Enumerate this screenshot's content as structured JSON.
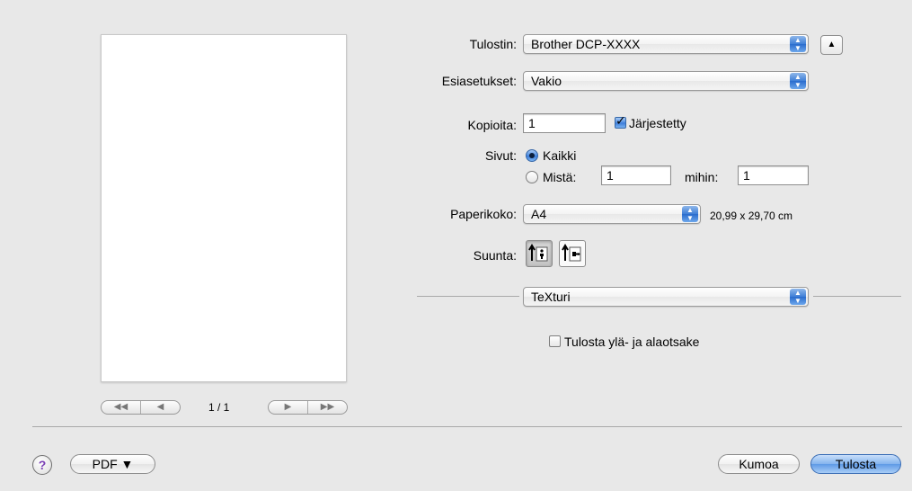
{
  "preview": {
    "page_counter": "1 / 1",
    "nav_first": "◀◀",
    "nav_prev": "◀",
    "nav_next": "▶",
    "nav_last": "▶▶"
  },
  "printer": {
    "label": "Tulostin:",
    "value": "Brother DCP-XXXX"
  },
  "presets": {
    "label": "Esiasetukset:",
    "value": "Vakio"
  },
  "copies": {
    "label": "Kopioita:",
    "value": "1",
    "collated_label": "Järjestetty",
    "collated_checked": true
  },
  "pages": {
    "label": "Sivut:",
    "all_label": "Kaikki",
    "from_label": "Mistä:",
    "from_value": "1",
    "to_label": "mihin:",
    "to_value": "1",
    "selected": "Kaikki"
  },
  "paper_size": {
    "label": "Paperikoko:",
    "value": "A4",
    "dimensions": "20,99 x 29,70 cm"
  },
  "orientation": {
    "label": "Suunta:",
    "selected": "portrait"
  },
  "section": {
    "value": "TeXturi"
  },
  "header_footer": {
    "label": "Tulosta ylä- ja alaotsake",
    "checked": false
  },
  "footer": {
    "help": "?",
    "pdf_label": "PDF ▼",
    "cancel_label": "Kumoa",
    "print_label": "Tulosta"
  },
  "colors": {
    "accent": "#3f7fd7",
    "background": "#e8e8e8"
  }
}
